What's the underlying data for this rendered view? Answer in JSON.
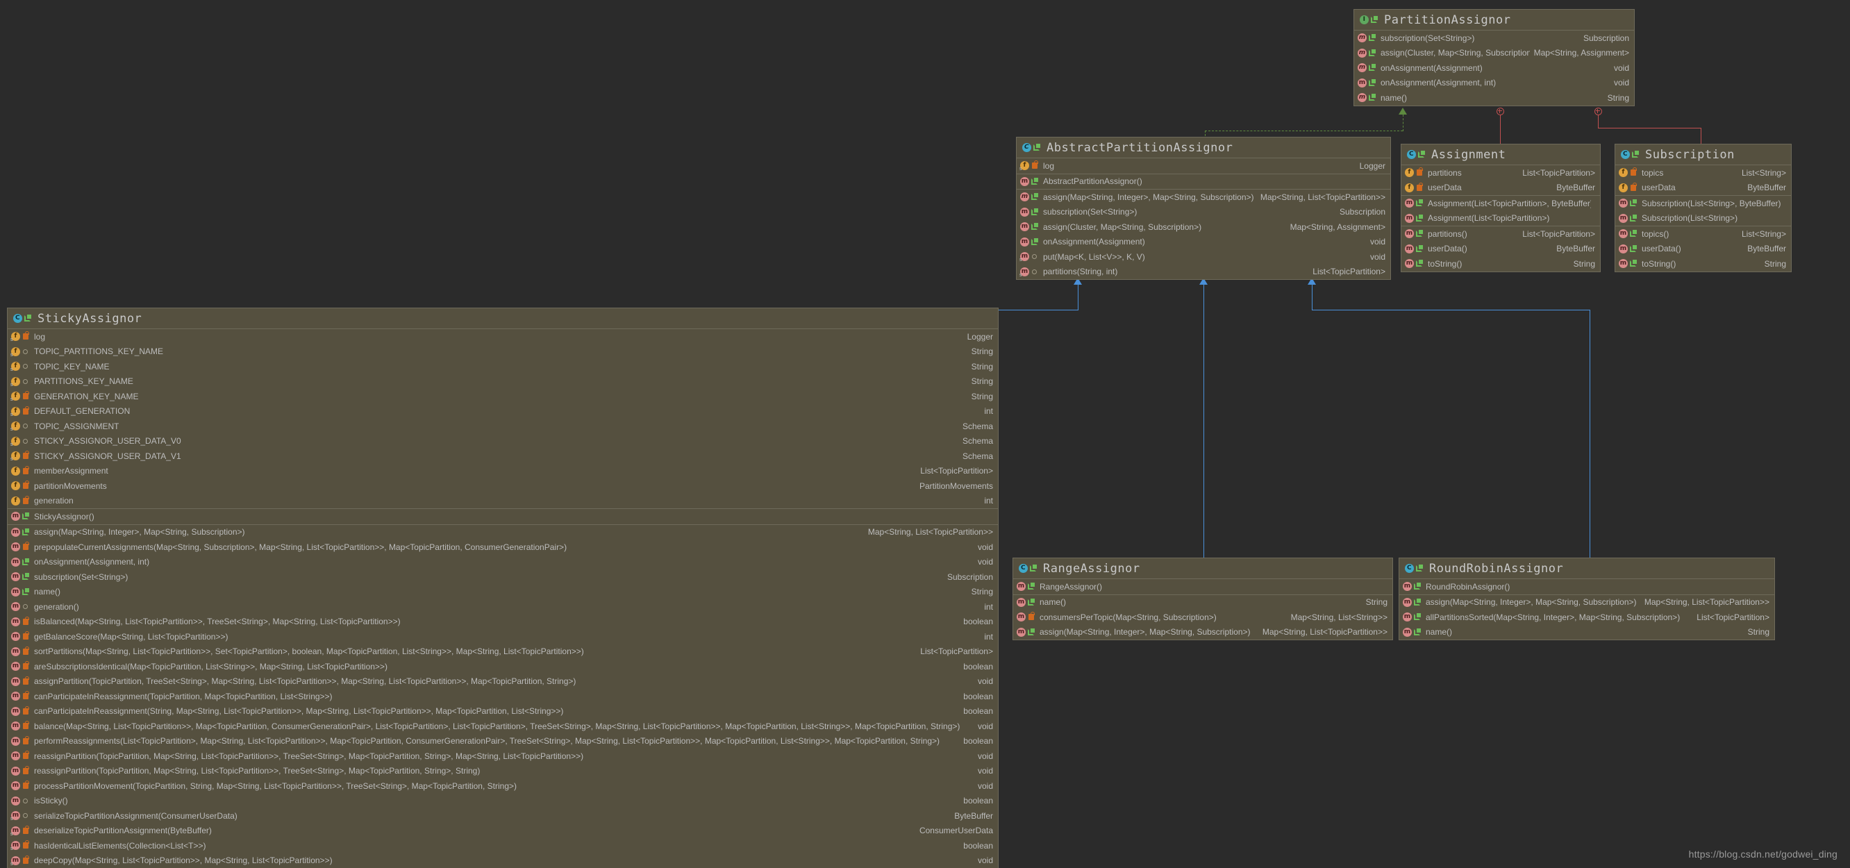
{
  "diagram": {
    "watermark": "https://blog.csdn.net/godwei_ding",
    "colors": {
      "background": "#2b2b2b",
      "class_body": "#55503f",
      "class_border": "#6e6a5a",
      "inheritance_line": "#4a90d9",
      "implements_line": "#5e8a3f",
      "inner_class_line": "#c05050",
      "text": "#bcbcbc"
    }
  },
  "classes": {
    "partition_assignor": {
      "name": "PartitionAssignor",
      "kind_icon": "interface-icon",
      "kind_label": "I",
      "sections": [
        {
          "rows": [
            {
              "icon": "method-abstract-icon",
              "kind": "m",
              "abstract": true,
              "vis": "public",
              "sig": "subscription(Set<String>)",
              "ret": "Subscription"
            },
            {
              "icon": "method-abstract-icon",
              "kind": "m",
              "abstract": true,
              "vis": "public",
              "sig": "assign(Cluster, Map<String, Subscription>)",
              "ret": "Map<String, Assignment>"
            },
            {
              "icon": "method-abstract-icon",
              "kind": "m",
              "abstract": true,
              "vis": "public",
              "sig": "onAssignment(Assignment)",
              "ret": "void"
            },
            {
              "icon": "method-icon",
              "kind": "m",
              "abstract": false,
              "vis": "public",
              "sig": "onAssignment(Assignment, int)",
              "ret": "void"
            },
            {
              "icon": "method-abstract-icon",
              "kind": "m",
              "abstract": true,
              "vis": "public",
              "sig": "name()",
              "ret": "String"
            }
          ]
        }
      ]
    },
    "abstract_partition_assignor": {
      "name": "AbstractPartitionAssignor",
      "kind_icon": "abstract-class-icon",
      "kind_label": "C",
      "sections": [
        {
          "rows": [
            {
              "icon": "static-field-icon",
              "kind": "sf",
              "vis": "private",
              "sig": "log",
              "ret": "Logger"
            }
          ]
        },
        {
          "rows": [
            {
              "icon": "method-icon",
              "kind": "m",
              "vis": "public",
              "sig": "AbstractPartitionAssignor()",
              "ret": ""
            }
          ]
        },
        {
          "rows": [
            {
              "icon": "method-abstract-icon",
              "kind": "m",
              "abstract": true,
              "vis": "public",
              "sig": "assign(Map<String, Integer>, Map<String, Subscription>)",
              "ret": "Map<String, List<TopicPartition>>"
            },
            {
              "icon": "method-icon",
              "kind": "m",
              "vis": "public",
              "sig": "subscription(Set<String>)",
              "ret": "Subscription"
            },
            {
              "icon": "method-icon",
              "kind": "m",
              "vis": "public",
              "sig": "assign(Cluster, Map<String, Subscription>)",
              "ret": "Map<String, Assignment>"
            },
            {
              "icon": "method-icon",
              "kind": "m",
              "vis": "public",
              "sig": "onAssignment(Assignment)",
              "ret": "void"
            },
            {
              "icon": "static-method-icon",
              "kind": "m",
              "vis": "package",
              "sig": "put(Map<K, List<V>>, K, V)",
              "ret": "void"
            },
            {
              "icon": "static-method-icon",
              "kind": "m",
              "vis": "package",
              "sig": "partitions(String, int)",
              "ret": "List<TopicPartition>"
            }
          ]
        }
      ]
    },
    "assignment": {
      "name": "Assignment",
      "kind_icon": "class-icon",
      "kind_label": "C",
      "sections": [
        {
          "rows": [
            {
              "icon": "field-icon",
              "kind": "f",
              "vis": "private",
              "sig": "partitions",
              "ret": "List<TopicPartition>"
            },
            {
              "icon": "field-icon",
              "kind": "f",
              "vis": "private",
              "sig": "userData",
              "ret": "ByteBuffer"
            }
          ]
        },
        {
          "rows": [
            {
              "icon": "method-icon",
              "kind": "m",
              "vis": "public",
              "sig": "Assignment(List<TopicPartition>, ByteBuffer)",
              "ret": ""
            },
            {
              "icon": "method-icon",
              "kind": "m",
              "vis": "public",
              "sig": "Assignment(List<TopicPartition>)",
              "ret": ""
            }
          ]
        },
        {
          "rows": [
            {
              "icon": "method-icon",
              "kind": "m",
              "vis": "public",
              "sig": "partitions()",
              "ret": "List<TopicPartition>"
            },
            {
              "icon": "method-icon",
              "kind": "m",
              "vis": "public",
              "sig": "userData()",
              "ret": "ByteBuffer"
            },
            {
              "icon": "method-icon",
              "kind": "m",
              "vis": "public",
              "sig": "toString()",
              "ret": "String"
            }
          ]
        }
      ]
    },
    "subscription": {
      "name": "Subscription",
      "kind_icon": "class-icon",
      "kind_label": "C",
      "sections": [
        {
          "rows": [
            {
              "icon": "field-icon",
              "kind": "f",
              "vis": "private",
              "sig": "topics",
              "ret": "List<String>"
            },
            {
              "icon": "field-icon",
              "kind": "f",
              "vis": "private",
              "sig": "userData",
              "ret": "ByteBuffer"
            }
          ]
        },
        {
          "rows": [
            {
              "icon": "method-icon",
              "kind": "m",
              "vis": "public",
              "sig": "Subscription(List<String>, ByteBuffer)",
              "ret": ""
            },
            {
              "icon": "method-icon",
              "kind": "m",
              "vis": "public",
              "sig": "Subscription(List<String>)",
              "ret": ""
            }
          ]
        },
        {
          "rows": [
            {
              "icon": "method-icon",
              "kind": "m",
              "vis": "public",
              "sig": "topics()",
              "ret": "List<String>"
            },
            {
              "icon": "method-icon",
              "kind": "m",
              "vis": "public",
              "sig": "userData()",
              "ret": "ByteBuffer"
            },
            {
              "icon": "method-icon",
              "kind": "m",
              "vis": "public",
              "sig": "toString()",
              "ret": "String"
            }
          ]
        }
      ]
    },
    "sticky_assignor": {
      "name": "StickyAssignor",
      "kind_icon": "class-icon",
      "kind_label": "C",
      "sections": [
        {
          "rows": [
            {
              "icon": "static-field-icon",
              "kind": "sf",
              "vis": "private",
              "sig": "log",
              "ret": "Logger"
            },
            {
              "icon": "static-field-icon",
              "kind": "sf",
              "vis": "package",
              "sig": "TOPIC_PARTITIONS_KEY_NAME",
              "ret": "String"
            },
            {
              "icon": "static-field-icon",
              "kind": "sf",
              "vis": "package",
              "sig": "TOPIC_KEY_NAME",
              "ret": "String"
            },
            {
              "icon": "static-field-icon",
              "kind": "sf",
              "vis": "package",
              "sig": "PARTITIONS_KEY_NAME",
              "ret": "String"
            },
            {
              "icon": "static-field-icon",
              "kind": "sf",
              "vis": "private",
              "sig": "GENERATION_KEY_NAME",
              "ret": "String"
            },
            {
              "icon": "static-field-icon",
              "kind": "sf",
              "vis": "private",
              "sig": "DEFAULT_GENERATION",
              "ret": "int"
            },
            {
              "icon": "static-field-icon",
              "kind": "sf",
              "vis": "package",
              "sig": "TOPIC_ASSIGNMENT",
              "ret": "Schema"
            },
            {
              "icon": "static-field-icon",
              "kind": "sf",
              "vis": "package",
              "sig": "STICKY_ASSIGNOR_USER_DATA_V0",
              "ret": "Schema"
            },
            {
              "icon": "static-field-icon",
              "kind": "sf",
              "vis": "private",
              "sig": "STICKY_ASSIGNOR_USER_DATA_V1",
              "ret": "Schema"
            },
            {
              "icon": "field-icon",
              "kind": "f",
              "vis": "private",
              "sig": "memberAssignment",
              "ret": "List<TopicPartition>"
            },
            {
              "icon": "field-icon",
              "kind": "f",
              "vis": "private",
              "sig": "partitionMovements",
              "ret": "PartitionMovements"
            },
            {
              "icon": "field-icon",
              "kind": "f",
              "vis": "private",
              "sig": "generation",
              "ret": "int"
            }
          ]
        },
        {
          "rows": [
            {
              "icon": "method-icon",
              "kind": "m",
              "vis": "public",
              "sig": "StickyAssignor()",
              "ret": ""
            }
          ]
        },
        {
          "rows": [
            {
              "icon": "method-icon",
              "kind": "m",
              "vis": "public",
              "sig": "assign(Map<String, Integer>, Map<String, Subscription>)",
              "ret": "Map<String, List<TopicPartition>>"
            },
            {
              "icon": "method-icon",
              "kind": "m",
              "vis": "private",
              "sig": "prepopulateCurrentAssignments(Map<String, Subscription>, Map<String, List<TopicPartition>>, Map<TopicPartition, ConsumerGenerationPair>)",
              "ret": "void"
            },
            {
              "icon": "method-icon",
              "kind": "m",
              "vis": "public",
              "sig": "onAssignment(Assignment, int)",
              "ret": "void"
            },
            {
              "icon": "method-icon",
              "kind": "m",
              "vis": "public",
              "sig": "subscription(Set<String>)",
              "ret": "Subscription"
            },
            {
              "icon": "method-icon",
              "kind": "m",
              "vis": "public",
              "sig": "name()",
              "ret": "String"
            },
            {
              "icon": "method-icon",
              "kind": "m",
              "vis": "package",
              "sig": "generation()",
              "ret": "int"
            },
            {
              "icon": "method-icon",
              "kind": "m",
              "vis": "private",
              "sig": "isBalanced(Map<String, List<TopicPartition>>, TreeSet<String>, Map<String, List<TopicPartition>>)",
              "ret": "boolean"
            },
            {
              "icon": "method-icon",
              "kind": "m",
              "vis": "private",
              "sig": "getBalanceScore(Map<String, List<TopicPartition>>)",
              "ret": "int"
            },
            {
              "icon": "method-icon",
              "kind": "m",
              "vis": "private",
              "sig": "sortPartitions(Map<String, List<TopicPartition>>, Set<TopicPartition>, boolean, Map<TopicPartition, List<String>>, Map<String, List<TopicPartition>>)",
              "ret": "List<TopicPartition>"
            },
            {
              "icon": "method-icon",
              "kind": "m",
              "vis": "private",
              "sig": "areSubscriptionsIdentical(Map<TopicPartition, List<String>>, Map<String, List<TopicPartition>>)",
              "ret": "boolean"
            },
            {
              "icon": "method-icon",
              "kind": "m",
              "vis": "private",
              "sig": "assignPartition(TopicPartition, TreeSet<String>, Map<String, List<TopicPartition>>, Map<String, List<TopicPartition>>, Map<TopicPartition, String>)",
              "ret": "void"
            },
            {
              "icon": "method-icon",
              "kind": "m",
              "vis": "private",
              "sig": "canParticipateInReassignment(TopicPartition, Map<TopicPartition, List<String>>)",
              "ret": "boolean"
            },
            {
              "icon": "method-icon",
              "kind": "m",
              "vis": "private",
              "sig": "canParticipateInReassignment(String, Map<String, List<TopicPartition>>, Map<String, List<TopicPartition>>, Map<TopicPartition, List<String>>)",
              "ret": "boolean"
            },
            {
              "icon": "method-icon",
              "kind": "m",
              "vis": "private",
              "sig": "balance(Map<String, List<TopicPartition>>, Map<TopicPartition, ConsumerGenerationPair>, List<TopicPartition>, List<TopicPartition>, TreeSet<String>, Map<String, List<TopicPartition>>, Map<TopicPartition, List<String>>, Map<TopicPartition, String>)",
              "ret": "void"
            },
            {
              "icon": "method-icon",
              "kind": "m",
              "vis": "private",
              "sig": "performReassignments(List<TopicPartition>, Map<String, List<TopicPartition>>, Map<TopicPartition, ConsumerGenerationPair>, TreeSet<String>, Map<String, List<TopicPartition>>, Map<TopicPartition, List<String>>, Map<TopicPartition, String>)",
              "ret": "boolean"
            },
            {
              "icon": "method-icon",
              "kind": "m",
              "vis": "private",
              "sig": "reassignPartition(TopicPartition, Map<String, List<TopicPartition>>, TreeSet<String>, Map<TopicPartition, String>, Map<String, List<TopicPartition>>)",
              "ret": "void"
            },
            {
              "icon": "method-icon",
              "kind": "m",
              "vis": "private",
              "sig": "reassignPartition(TopicPartition, Map<String, List<TopicPartition>>, TreeSet<String>, Map<TopicPartition, String>, String)",
              "ret": "void"
            },
            {
              "icon": "method-icon",
              "kind": "m",
              "vis": "private",
              "sig": "processPartitionMovement(TopicPartition, String, Map<String, List<TopicPartition>>, TreeSet<String>, Map<TopicPartition, String>)",
              "ret": "void"
            },
            {
              "icon": "method-icon",
              "kind": "m",
              "vis": "package",
              "sig": "isSticky()",
              "ret": "boolean"
            },
            {
              "icon": "static-method-icon",
              "kind": "m",
              "vis": "package",
              "sig": "serializeTopicPartitionAssignment(ConsumerUserData)",
              "ret": "ByteBuffer"
            },
            {
              "icon": "static-method-icon",
              "kind": "m",
              "vis": "private",
              "sig": "deserializeTopicPartitionAssignment(ByteBuffer)",
              "ret": "ConsumerUserData"
            },
            {
              "icon": "static-method-icon",
              "kind": "m",
              "vis": "private",
              "sig": "hasIdenticalListElements(Collection<List<T>>)",
              "ret": "boolean"
            },
            {
              "icon": "static-method-icon",
              "kind": "m",
              "vis": "private",
              "sig": "deepCopy(Map<String, List<TopicPartition>>, Map<String, List<TopicPartition>>)",
              "ret": "void"
            }
          ]
        }
      ]
    },
    "range_assignor": {
      "name": "RangeAssignor",
      "kind_icon": "class-icon",
      "kind_label": "C",
      "sections": [
        {
          "rows": [
            {
              "icon": "method-icon",
              "kind": "m",
              "vis": "public",
              "sig": "RangeAssignor()",
              "ret": ""
            }
          ]
        },
        {
          "rows": [
            {
              "icon": "method-icon",
              "kind": "m",
              "vis": "public",
              "sig": "name()",
              "ret": "String"
            },
            {
              "icon": "method-icon",
              "kind": "m",
              "vis": "private",
              "sig": "consumersPerTopic(Map<String, Subscription>)",
              "ret": "Map<String, List<String>>"
            },
            {
              "icon": "method-icon",
              "kind": "m",
              "vis": "public",
              "sig": "assign(Map<String, Integer>, Map<String, Subscription>)",
              "ret": "Map<String, List<TopicPartition>>"
            }
          ]
        }
      ]
    },
    "round_robin_assignor": {
      "name": "RoundRobinAssignor",
      "kind_icon": "class-icon",
      "kind_label": "C",
      "sections": [
        {
          "rows": [
            {
              "icon": "method-icon",
              "kind": "m",
              "vis": "public",
              "sig": "RoundRobinAssignor()",
              "ret": ""
            }
          ]
        },
        {
          "rows": [
            {
              "icon": "method-icon",
              "kind": "m",
              "vis": "public",
              "sig": "assign(Map<String, Integer>, Map<String, Subscription>)",
              "ret": "Map<String, List<TopicPartition>>"
            },
            {
              "icon": "method-icon",
              "kind": "m",
              "vis": "public",
              "sig": "allPartitionsSorted(Map<String, Integer>, Map<String, Subscription>)",
              "ret": "List<TopicPartition>"
            },
            {
              "icon": "method-icon",
              "kind": "m",
              "vis": "public",
              "sig": "name()",
              "ret": "String"
            }
          ]
        }
      ]
    }
  }
}
